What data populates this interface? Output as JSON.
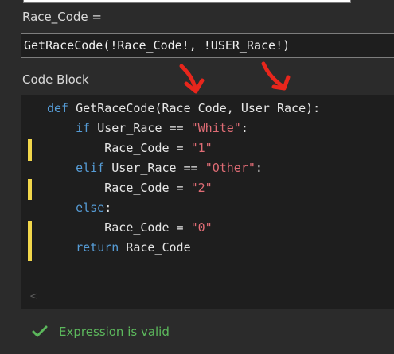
{
  "expression": {
    "label": "Race_Code =",
    "value": "GetRaceCode(!Race_Code!, !USER_Race!)"
  },
  "code_block": {
    "label": "Code Block",
    "lines": [
      [
        {
          "t": "def ",
          "c": "kw"
        },
        {
          "t": "GetRaceCode(Race_Code, User_Race):",
          "c": "fn"
        }
      ],
      [
        {
          "t": "    if ",
          "c": "kw"
        },
        {
          "t": "User_Race == ",
          "c": "op"
        },
        {
          "t": "\"White\"",
          "c": "str"
        },
        {
          "t": ":",
          "c": "op"
        }
      ],
      [
        {
          "t": "        Race_Code = ",
          "c": "op"
        },
        {
          "t": "\"1\"",
          "c": "str"
        }
      ],
      [
        {
          "t": "    elif ",
          "c": "kw"
        },
        {
          "t": "User_Race == ",
          "c": "op"
        },
        {
          "t": "\"Other\"",
          "c": "str"
        },
        {
          "t": ":",
          "c": "op"
        }
      ],
      [
        {
          "t": "        Race_Code = ",
          "c": "op"
        },
        {
          "t": "\"2\"",
          "c": "str"
        }
      ],
      [
        {
          "t": "    else",
          "c": "kw"
        },
        {
          "t": ":",
          "c": "op"
        }
      ],
      [
        {
          "t": "        Race_Code = ",
          "c": "op"
        },
        {
          "t": "\"0\"",
          "c": "str"
        }
      ],
      [
        {
          "t": "    return ",
          "c": "kw"
        },
        {
          "t": "Race_Code",
          "c": "op"
        }
      ]
    ],
    "scroll_left_glyph": "<"
  },
  "validation": {
    "message": "Expression is valid",
    "icon": "check-icon",
    "color": "#5cb85c"
  },
  "annotations": {
    "arrow_color": "#e8261c",
    "arrow_count": 2
  }
}
